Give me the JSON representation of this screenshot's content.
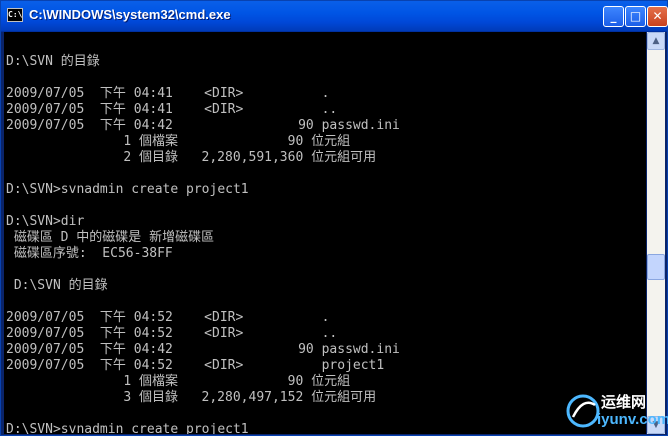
{
  "window": {
    "title": "C:\\WINDOWS\\system32\\cmd.exe",
    "icon_text": "C:\\",
    "minimize_label": "_",
    "maximize_label": "□",
    "close_label": "✕"
  },
  "console": {
    "lines": [
      "",
      "D:\\SVN 的目錄",
      "",
      "2009/07/05  下午 04:41    <DIR>          .",
      "2009/07/05  下午 04:41    <DIR>          ..",
      "2009/07/05  下午 04:42                90 passwd.ini",
      "               1 個檔案              90 位元組",
      "               2 個目錄   2,280,591,360 位元組可用",
      "",
      "D:\\SVN>svnadmin create project1",
      "",
      "D:\\SVN>dir",
      " 磁碟區 D 中的磁碟是 新增磁碟區",
      " 磁碟區序號:  EC56-38FF",
      "",
      " D:\\SVN 的目錄",
      "",
      "2009/07/05  下午 04:52    <DIR>          .",
      "2009/07/05  下午 04:52    <DIR>          ..",
      "2009/07/05  下午 04:42                90 passwd.ini",
      "2009/07/05  下午 04:52    <DIR>          project1",
      "               1 個檔案              90 位元組",
      "               3 個目錄   2,280,497,152 位元組可用",
      "",
      "D:\\SVN>svnadmin create project1"
    ]
  },
  "scrollbar": {
    "up_icon": "scroll-up-arrow-icon",
    "down_icon": "scroll-down-arrow-icon",
    "thumb_position": 0.6
  },
  "watermark": {
    "text_cn": "运维网",
    "text_en": "iyunv.com"
  },
  "colors": {
    "titlebar": "#0055e5",
    "console_bg": "#000000",
    "console_fg": "#c0c0c0",
    "close_button": "#d8562f"
  }
}
